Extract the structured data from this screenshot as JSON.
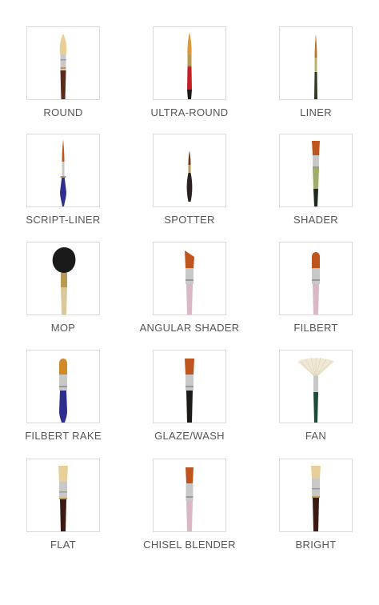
{
  "brushes": [
    {
      "label": "ROUND",
      "icon": "round-brush-icon"
    },
    {
      "label": "ULTRA-ROUND",
      "icon": "ultra-round-brush-icon"
    },
    {
      "label": "LINER",
      "icon": "liner-brush-icon"
    },
    {
      "label": "SCRIPT-LINER",
      "icon": "script-liner-brush-icon"
    },
    {
      "label": "SPOTTER",
      "icon": "spotter-brush-icon"
    },
    {
      "label": "SHADER",
      "icon": "shader-brush-icon"
    },
    {
      "label": "MOP",
      "icon": "mop-brush-icon"
    },
    {
      "label": "ANGULAR SHADER",
      "icon": "angular-shader-brush-icon"
    },
    {
      "label": "FILBERT",
      "icon": "filbert-brush-icon"
    },
    {
      "label": "FILBERT RAKE",
      "icon": "filbert-rake-brush-icon"
    },
    {
      "label": "GLAZE/WASH",
      "icon": "glaze-wash-brush-icon"
    },
    {
      "label": "FAN",
      "icon": "fan-brush-icon"
    },
    {
      "label": "FLAT",
      "icon": "flat-brush-icon"
    },
    {
      "label": "CHISEL BLENDER",
      "icon": "chisel-blender-brush-icon"
    },
    {
      "label": "BRIGHT",
      "icon": "bright-brush-icon"
    }
  ],
  "colors": {
    "frame_border": "#d9d9d9",
    "label_text": "#555555",
    "natural_bristle": "#e8cf98",
    "synthetic_bristle": "#c0541e",
    "ferrule_silver": "#c8c8c8",
    "ferrule_gold": "#b89a52",
    "handle_black": "#1e1a18",
    "handle_blue": "#2e2f8c",
    "handle_red": "#c21f26",
    "handle_green": "#1f4a36",
    "handle_pink": "#d9b7c6"
  }
}
